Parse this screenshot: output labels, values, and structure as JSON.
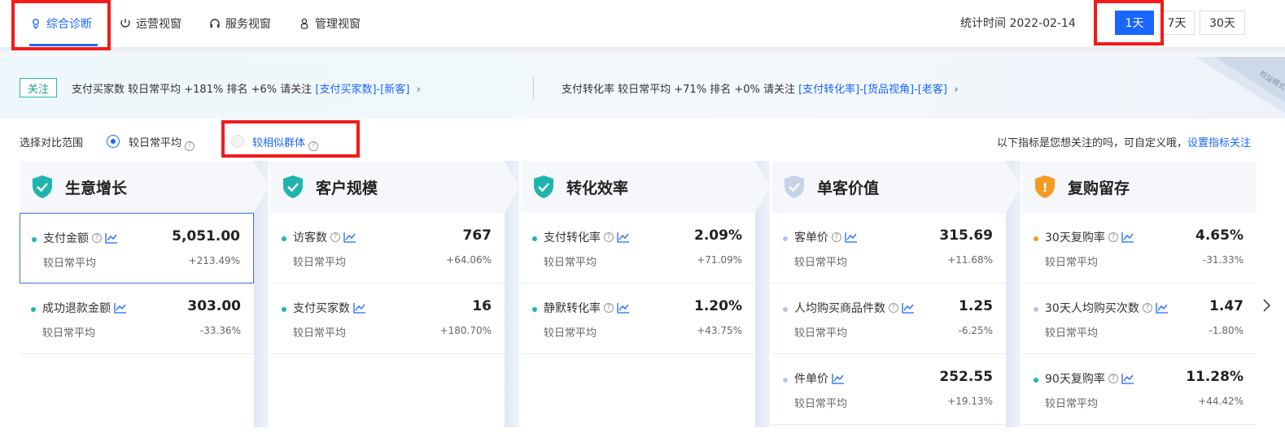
{
  "nav": {
    "tabs": [
      {
        "label": "综合诊断",
        "icon": "diagnosis-icon"
      },
      {
        "label": "运营视窗",
        "icon": "operations-icon"
      },
      {
        "label": "服务视窗",
        "icon": "headset-icon"
      },
      {
        "label": "管理视窗",
        "icon": "manage-icon"
      }
    ],
    "stat_time_label": "统计时间 2022-02-14",
    "ranges": [
      "1天",
      "7天",
      "30天"
    ],
    "active_range": "1天"
  },
  "alert": {
    "tag": "关注",
    "item1_text": "支付买家数 较日常平均 +181%   排名 +6%   请关注 ",
    "item1_link": "[支付买家数]-[新客]",
    "item2_text": "支付转化率 较日常平均 +71%   排名 +0%   请关注 ",
    "item2_link": "[支付转化率]-[货品视角]-[老客]",
    "ribbon": "权益模式"
  },
  "compare": {
    "label": "选择对比范围",
    "opt1": "较日常平均",
    "opt2": "较相似群体",
    "tip": "以下指标是您想关注的吗，可自定义哦，",
    "tip_link": "设置指标关注"
  },
  "columns": [
    {
      "title": "生意增长",
      "metrics": [
        {
          "name": "支付金额",
          "value": "5,051.00",
          "sub": "较日常平均",
          "change": "+213.49%"
        },
        {
          "name": "成功退款金额",
          "value": "303.00",
          "sub": "较日常平均",
          "change": "-33.36%"
        }
      ]
    },
    {
      "title": "客户规模",
      "metrics": [
        {
          "name": "访客数",
          "value": "767",
          "sub": "较日常平均",
          "change": "+64.06%"
        },
        {
          "name": "支付买家数",
          "value": "16",
          "sub": "较日常平均",
          "change": "+180.70%"
        }
      ]
    },
    {
      "title": "转化效率",
      "metrics": [
        {
          "name": "支付转化率",
          "value": "2.09%",
          "sub": "较日常平均",
          "change": "+71.09%"
        },
        {
          "name": "静默转化率",
          "value": "1.20%",
          "sub": "较日常平均",
          "change": "+43.75%"
        }
      ]
    },
    {
      "title": "单客价值",
      "metrics": [
        {
          "name": "客单价",
          "value": "315.69",
          "sub": "较日常平均",
          "change": "+11.68%"
        },
        {
          "name": "人均购买商品件数",
          "value": "1.25",
          "sub": "较日常平均",
          "change": "-6.25%"
        },
        {
          "name": "件单价",
          "value": "252.55",
          "sub": "较日常平均",
          "change": "+19.13%"
        }
      ]
    },
    {
      "title": "复购留存",
      "metrics": [
        {
          "name": "30天复购率",
          "value": "4.65%",
          "sub": "较日常平均",
          "change": "-31.33%"
        },
        {
          "name": "30天人均购买次数",
          "value": "1.47",
          "sub": "较日常平均",
          "change": "-1.80%"
        },
        {
          "name": "90天复购率",
          "value": "11.28%",
          "sub": "较日常平均",
          "change": "+44.42%"
        }
      ]
    }
  ],
  "colors": {
    "accent": "#1a66ff",
    "teal": "#1fb5ad",
    "highlight_box": "#f31a1a",
    "orange": "#f59a23"
  }
}
